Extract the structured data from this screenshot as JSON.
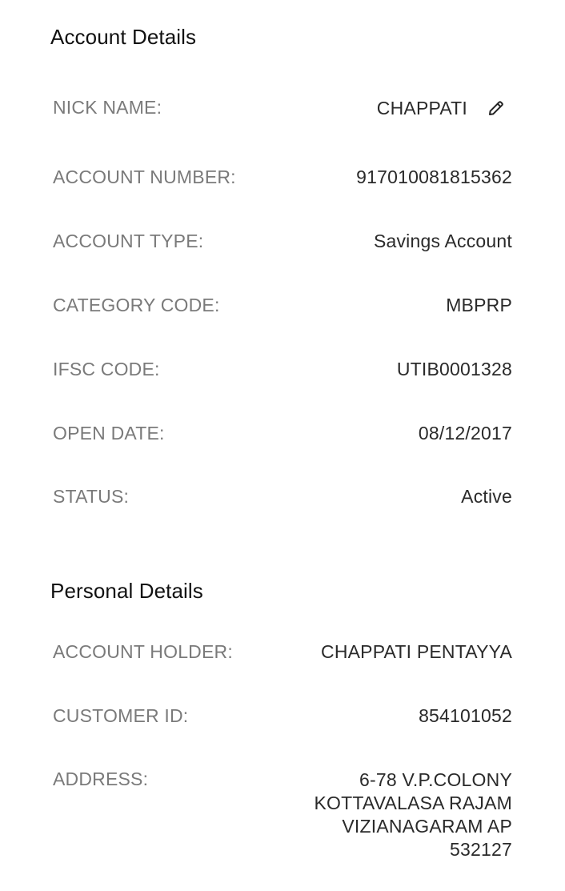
{
  "account_details": {
    "title": "Account Details",
    "nick_name": {
      "label": "NICK NAME:",
      "value": "CHAPPATI",
      "edit_icon": "pencil-icon"
    },
    "account_number": {
      "label": "ACCOUNT NUMBER:",
      "value": "917010081815362"
    },
    "account_type": {
      "label": "ACCOUNT TYPE:",
      "value": "Savings Account"
    },
    "category_code": {
      "label": "CATEGORY CODE:",
      "value": "MBPRP"
    },
    "ifsc_code": {
      "label": "IFSC CODE:",
      "value": "UTIB0001328"
    },
    "open_date": {
      "label": "OPEN DATE:",
      "value": "08/12/2017"
    },
    "status": {
      "label": "STATUS:",
      "value": "Active"
    }
  },
  "personal_details": {
    "title": "Personal Details",
    "account_holder": {
      "label": "ACCOUNT HOLDER:",
      "value": "CHAPPATI PENTAYYA"
    },
    "customer_id": {
      "label": "CUSTOMER ID:",
      "value": "854101052"
    },
    "address": {
      "label": "ADDRESS:",
      "value": "6-78 V.P.COLONY\nKOTTAVALASA RAJAM\nVIZIANAGARAM AP\n532127"
    }
  }
}
